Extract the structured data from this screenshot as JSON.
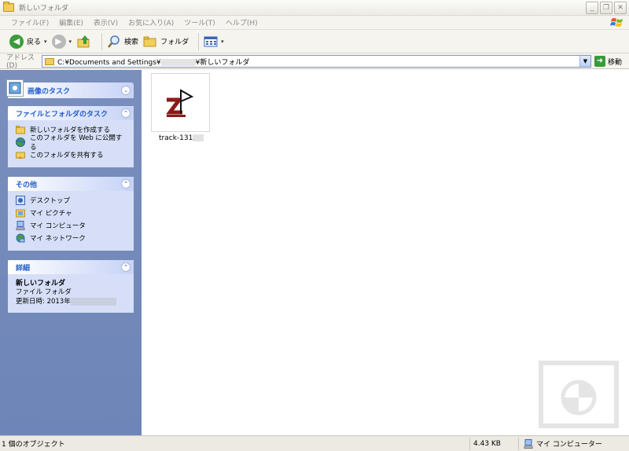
{
  "window": {
    "title": "新しいフォルダ",
    "controls": {
      "minimize": "_",
      "restore": "❐",
      "close": "✕"
    }
  },
  "menu": [
    "ファイル(F)",
    "編集(E)",
    "表示(V)",
    "お気に入り(A)",
    "ツール(T)",
    "ヘルプ(H)"
  ],
  "toolbar": {
    "back_label": "戻る",
    "search_label": "検索",
    "folders_label": "フォルダ"
  },
  "address": {
    "label": "アドレス(D)",
    "path_prefix": "C:¥Documents and Settings¥",
    "path_suffix": "¥新しいフォルダ",
    "go_label": "移動"
  },
  "sidebar": {
    "tasks_title": "画像のタスク",
    "file_tasks": {
      "title": "ファイルとフォルダのタスク",
      "items": [
        "新しいフォルダを作成する",
        "このフォルダを Web に公開する",
        "このフォルダを共有する"
      ]
    },
    "other": {
      "title": "その他",
      "items": [
        "デスクトップ",
        "マイ ピクチャ",
        "マイ コンピュータ",
        "マイ ネットワーク"
      ]
    },
    "details": {
      "title": "詳細",
      "name": "新しいフォルダ",
      "type": "ファイル フォルダ",
      "modified": "更新日時: 2013年"
    }
  },
  "files": [
    {
      "name": "track-131",
      "icon": "track-file-icon"
    }
  ],
  "status": {
    "objects": "1 個のオブジェクト",
    "size": "4.43 KB",
    "zone": "マイ コンピューター"
  },
  "colors": {
    "sidebar_bg": "#7a8fbc",
    "panel_bg": "#d6dff7",
    "panel_title": "#215dc6"
  }
}
